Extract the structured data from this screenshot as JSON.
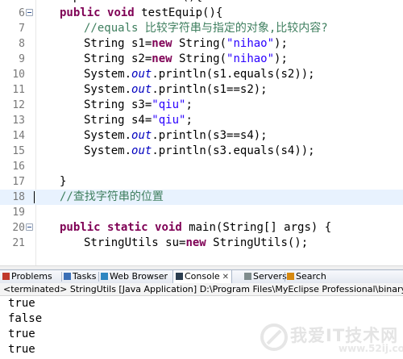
{
  "editor": {
    "lines": [
      {
        "n": "6",
        "fold": true,
        "parts": [
          [
            "kw",
            "public"
          ],
          [
            "t",
            " "
          ],
          [
            "kw",
            "void"
          ],
          [
            "t",
            " testEquip(){"
          ]
        ]
      },
      {
        "n": "7",
        "indent": true,
        "parts": [
          [
            "cmt",
            "//equals 比较字符串与指定的对象,比较内容?"
          ]
        ]
      },
      {
        "n": "8",
        "indent": true,
        "parts": [
          [
            "t",
            "String s1="
          ],
          [
            "kw",
            "new"
          ],
          [
            "t",
            " String("
          ],
          [
            "str",
            "\"nihao\""
          ],
          [
            "t",
            ");"
          ]
        ]
      },
      {
        "n": "9",
        "indent": true,
        "parts": [
          [
            "t",
            "String s2="
          ],
          [
            "kw",
            "new"
          ],
          [
            "t",
            " String("
          ],
          [
            "str",
            "\"nihao\""
          ],
          [
            "t",
            ");"
          ]
        ]
      },
      {
        "n": "10",
        "indent": true,
        "parts": [
          [
            "t",
            "System."
          ],
          [
            "fld",
            "out"
          ],
          [
            "t",
            ".println(s1.equals(s2));"
          ]
        ]
      },
      {
        "n": "11",
        "indent": true,
        "parts": [
          [
            "t",
            "System."
          ],
          [
            "fld",
            "out"
          ],
          [
            "t",
            ".println(s1==s2);"
          ]
        ]
      },
      {
        "n": "12",
        "indent": true,
        "parts": [
          [
            "t",
            "String s3="
          ],
          [
            "str",
            "\"qiu\""
          ],
          [
            "t",
            ";"
          ]
        ]
      },
      {
        "n": "13",
        "indent": true,
        "parts": [
          [
            "t",
            "String s4="
          ],
          [
            "str",
            "\"qiu\""
          ],
          [
            "t",
            ";"
          ]
        ]
      },
      {
        "n": "14",
        "indent": true,
        "parts": [
          [
            "t",
            "System."
          ],
          [
            "fld",
            "out"
          ],
          [
            "t",
            ".println(s3==s4);"
          ]
        ]
      },
      {
        "n": "15",
        "indent": true,
        "parts": [
          [
            "t",
            "System."
          ],
          [
            "fld",
            "out"
          ],
          [
            "t",
            ".println(s3.equals(s4));"
          ]
        ]
      },
      {
        "n": "16",
        "parts": []
      },
      {
        "n": "17",
        "parts": [
          [
            "t",
            "}"
          ]
        ]
      },
      {
        "n": "18",
        "current": true,
        "parts": [
          [
            "cmt",
            "//查找字符串的位置"
          ]
        ]
      },
      {
        "n": "19",
        "parts": []
      },
      {
        "n": "20",
        "fold": true,
        "parts": [
          [
            "kw",
            "public"
          ],
          [
            "t",
            " "
          ],
          [
            "kw",
            "static"
          ],
          [
            "t",
            " "
          ],
          [
            "kw",
            "void"
          ],
          [
            "t",
            " main(String[] args) {"
          ]
        ]
      },
      {
        "n": "21",
        "indent": true,
        "parts": [
          [
            "t",
            "StringUtils su="
          ],
          [
            "kw",
            "new"
          ],
          [
            "t",
            " StringUtils();"
          ]
        ]
      }
    ]
  },
  "views": {
    "tabs": [
      {
        "label": "Problems",
        "icon": "problems-icon",
        "color": "#c0392b"
      },
      {
        "label": "Tasks",
        "icon": "tasks-icon",
        "color": "#3b6fb6"
      },
      {
        "label": "Web Browser",
        "icon": "web-browser-icon",
        "color": "#2e86c1"
      },
      {
        "label": "Console",
        "icon": "console-icon",
        "color": "#2c3e50",
        "active": true
      },
      {
        "label": "Servers",
        "icon": "servers-icon",
        "color": "#7f8c8d"
      },
      {
        "label": "Search",
        "icon": "search-icon",
        "color": "#d68910"
      }
    ],
    "close_glyph": "✕"
  },
  "console": {
    "terminated": "<terminated> StringUtils [Java Application] D:\\Program Files\\MyEclipse Professional\\binary\\com",
    "output": [
      "true",
      "false",
      "true",
      "true"
    ]
  },
  "watermark": {
    "text": "我爱IT技术网",
    "url": "www.52ij.com"
  }
}
